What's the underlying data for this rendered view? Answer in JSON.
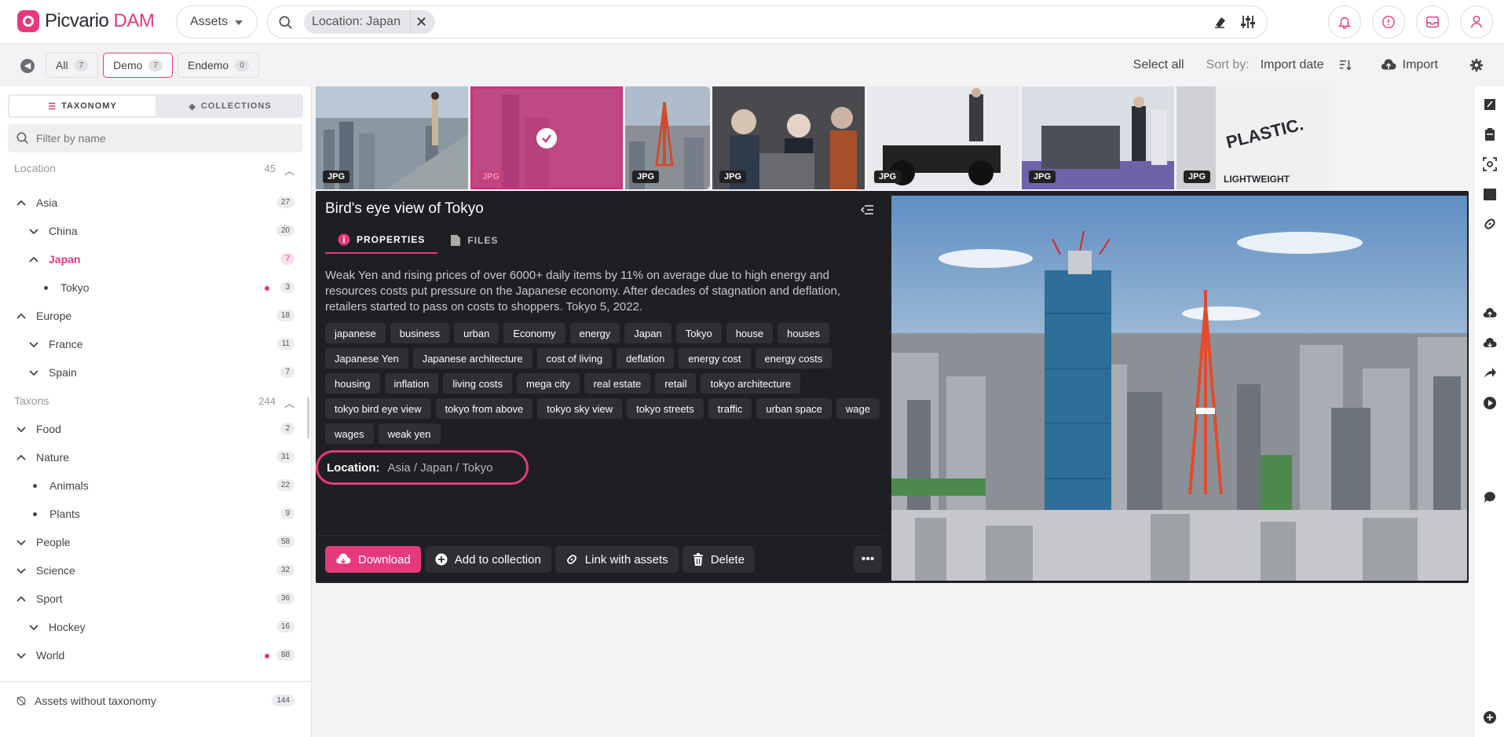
{
  "app": {
    "brand_main": "Picvario",
    "brand_accent": "DAM",
    "accent_color": "#e6397d"
  },
  "topbar": {
    "assets_select": "Assets",
    "search_chip": "Location: Japan"
  },
  "subbar": {
    "tabs": [
      {
        "label": "All",
        "count": "7"
      },
      {
        "label": "Demo",
        "count": "7"
      },
      {
        "label": "Endemo",
        "count": "0"
      }
    ],
    "select_all": "Select all",
    "sort_label": "Sort by:",
    "sort_value": "Import date",
    "import_label": "Import"
  },
  "sidebar": {
    "tab_taxonomy": "TAXONOMY",
    "tab_collections": "COLLECTIONS",
    "filter_placeholder": "Filter by name",
    "sections": {
      "location": {
        "label": "Location",
        "count": "45"
      },
      "taxons": {
        "label": "Taxons",
        "count": "244"
      }
    },
    "items": {
      "asia": {
        "label": "Asia",
        "count": "27"
      },
      "china": {
        "label": "China",
        "count": "20"
      },
      "japan": {
        "label": "Japan",
        "count": "7"
      },
      "tokyo": {
        "label": "Tokyo",
        "count": "3"
      },
      "europe": {
        "label": "Europe",
        "count": "18"
      },
      "france": {
        "label": "France",
        "count": "11"
      },
      "spain": {
        "label": "Spain",
        "count": "7"
      },
      "food": {
        "label": "Food",
        "count": "2"
      },
      "nature": {
        "label": "Nature",
        "count": "31"
      },
      "animals": {
        "label": "Animals",
        "count": "22"
      },
      "plants": {
        "label": "Plants",
        "count": "9"
      },
      "people": {
        "label": "People",
        "count": "58"
      },
      "science": {
        "label": "Science",
        "count": "32"
      },
      "sport": {
        "label": "Sport",
        "count": "36"
      },
      "hockey": {
        "label": "Hockey",
        "count": "16"
      },
      "world": {
        "label": "World",
        "count": "88"
      }
    },
    "footer": {
      "label": "Assets without taxonomy",
      "count": "144"
    }
  },
  "thumbnails": {
    "badge": "JPG"
  },
  "detail": {
    "title": "Bird's eye view of Tokyo",
    "tab_properties": "PROPERTIES",
    "tab_files": "FILES",
    "description": "Weak Yen and rising prices of over 6000+ daily items by 11%  on average due to high energy and resources costs put pressure on the Japanese economy.  After decades of stagnation and deflation, retailers started to pass on costs to shoppers. Tokyo 5, 2022.",
    "tags": [
      "japanese",
      "business",
      "urban",
      "Economy",
      "energy",
      "Japan",
      "Tokyo",
      "house",
      "houses",
      "Japanese Yen",
      "Japanese architecture",
      "cost of living",
      "deflation",
      "energy cost",
      "energy costs",
      "housing",
      "inflation",
      "living costs",
      "mega city",
      "real estate",
      "retail",
      "tokyo architecture",
      "tokyo bird eye view",
      "tokyo from above",
      "tokyo sky view",
      "tokyo streets",
      "traffic",
      "urban space",
      "wage",
      "wages",
      "weak yen"
    ],
    "location_label": "Location:",
    "location_value": "Asia / Japan / Tokyo",
    "actions": {
      "download": "Download",
      "add_to_collection": "Add to collection",
      "link_with_assets": "Link with assets",
      "delete": "Delete"
    }
  }
}
